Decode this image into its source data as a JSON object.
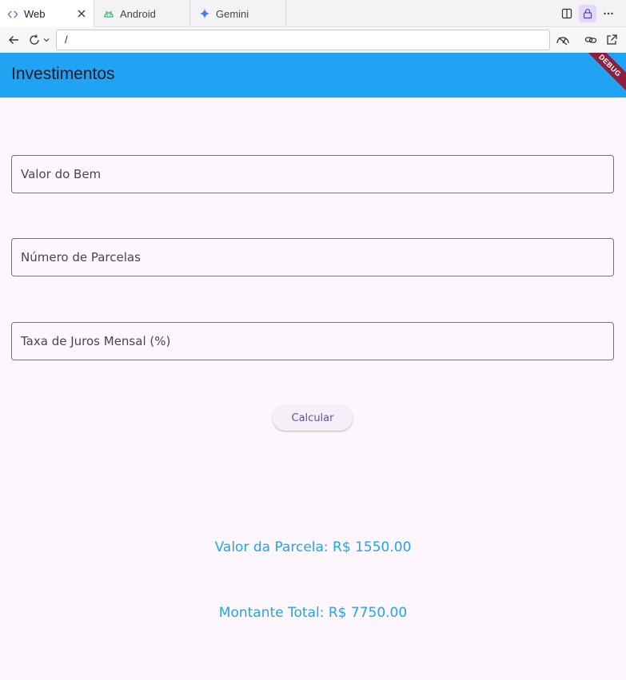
{
  "browser": {
    "tabs": [
      {
        "label": "Web",
        "icon": "code-brackets-icon",
        "active": true
      },
      {
        "label": "Android",
        "icon": "android-icon",
        "active": false
      },
      {
        "label": "Gemini",
        "icon": "gemini-sparkle-icon",
        "active": false
      }
    ],
    "url": "/"
  },
  "app": {
    "title": "Investimentos",
    "debug_banner": "DEBUG",
    "primary_color": "#21a3f3",
    "background_color": "#fdf7fd"
  },
  "form": {
    "valor_bem_label": "Valor do Bem",
    "numero_parcelas_label": "Número de Parcelas",
    "taxa_juros_label": "Taxa de Juros Mensal (%)",
    "calcular_label": "Calcular"
  },
  "results": {
    "valor_parcela": "Valor da Parcela: R$ 1550.00",
    "montante_total": "Montante Total: R$ 7750.00"
  }
}
